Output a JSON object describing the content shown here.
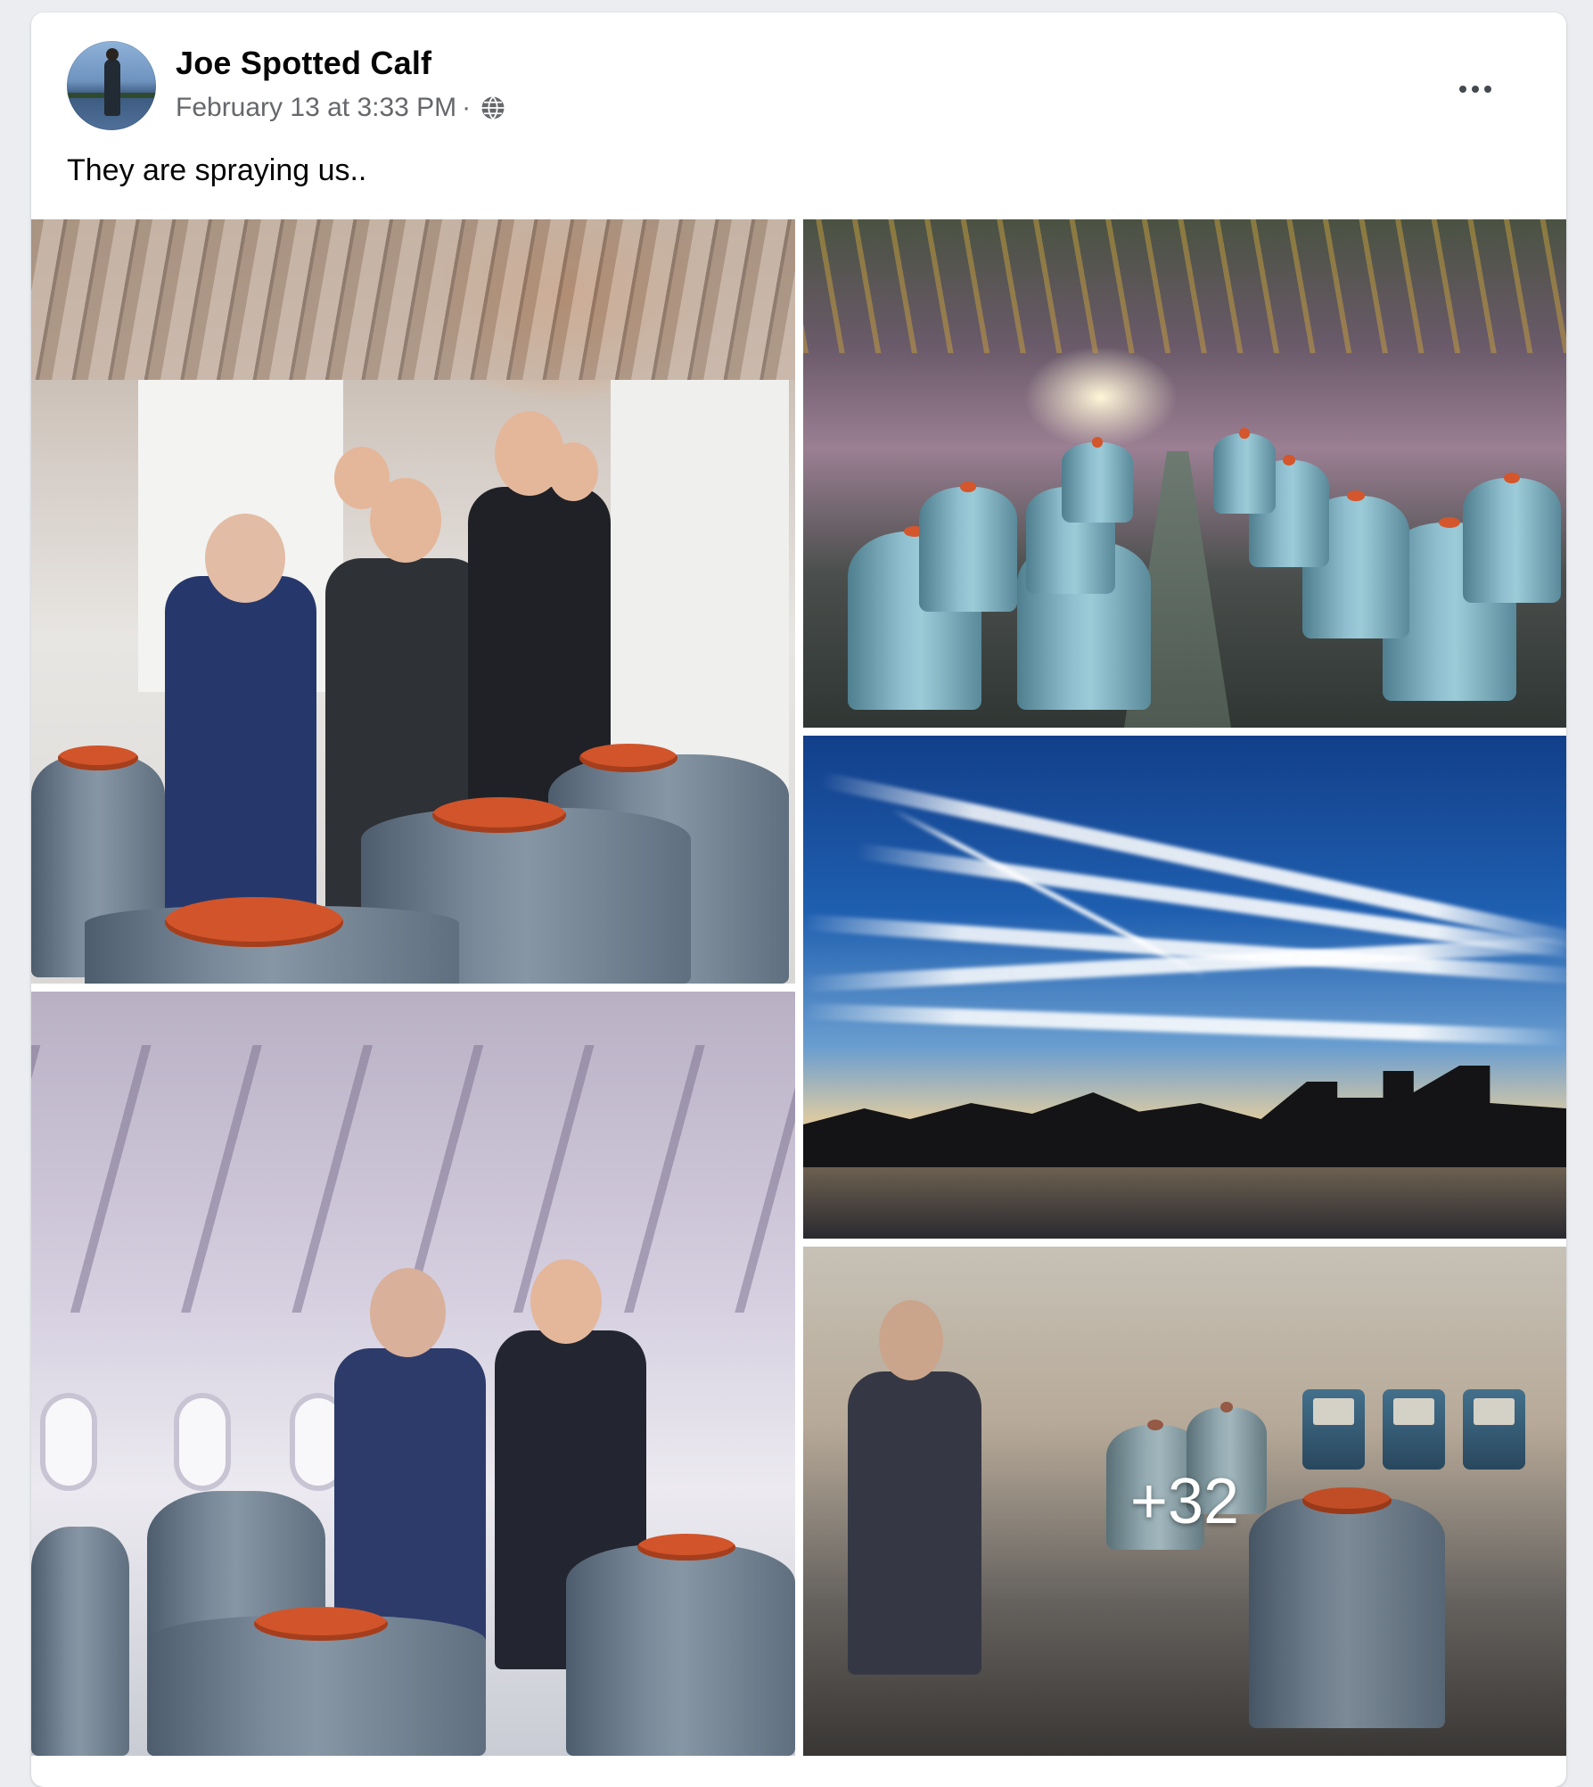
{
  "post": {
    "author": "Joe Spotted Calf",
    "timestamp": "February 13 at 3:33 PM",
    "separator": "·",
    "privacy_icon": "globe-icon",
    "text": "They are spraying us..",
    "more_menu_icon": "more-options-icon"
  },
  "photos": {
    "overflow_count": "+32",
    "items": [
      {
        "subject": "group-in-aircraft-with-tanks"
      },
      {
        "subject": "cabin-rows-of-tanks"
      },
      {
        "subject": "contrails-over-city"
      },
      {
        "subject": "group-in-cabin-blurry"
      },
      {
        "subject": "woman-in-cabin-with-tanks"
      }
    ]
  },
  "colors": {
    "author_text": "#050505",
    "meta_text": "#65676b",
    "card_bg": "#ffffff",
    "page_bg": "#ebedf0"
  }
}
